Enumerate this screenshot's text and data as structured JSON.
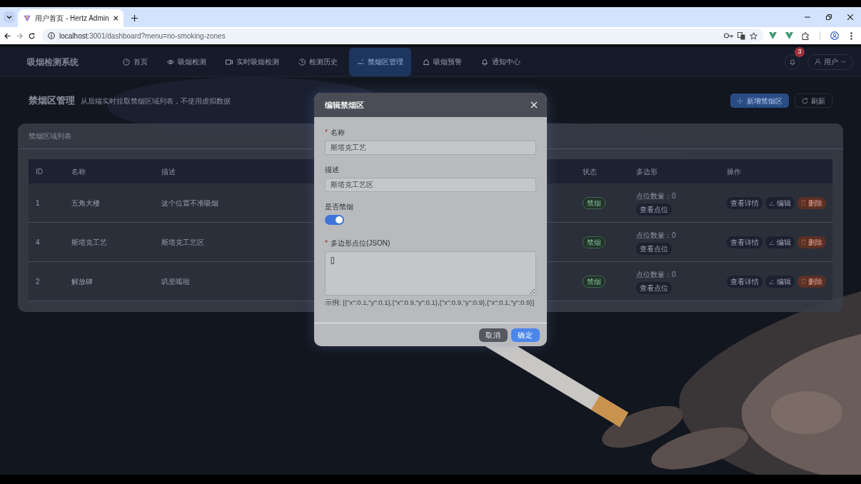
{
  "browser": {
    "tab_title": "用户首页 - Hertz Admin",
    "url_host": "localhost",
    "url_rest": ":3001/dashboard?menu=no-smoking-zones"
  },
  "app": {
    "brand": "吸烟检测系统",
    "nav": [
      {
        "label": "首页",
        "selected": false
      },
      {
        "label": "吸烟检测",
        "selected": false
      },
      {
        "label": "实时吸烟检测",
        "selected": false
      },
      {
        "label": "检测历史",
        "selected": false
      },
      {
        "label": "禁烟区管理",
        "selected": true
      },
      {
        "label": "吸烟预警",
        "selected": false
      },
      {
        "label": "通知中心",
        "selected": false
      }
    ],
    "notification_count": "3",
    "user": "用户"
  },
  "page": {
    "title": "禁烟区管理",
    "subtitle": "从后端实时拉取禁烟区域列表，不使用虚拟数据",
    "add_button": "新增禁烟区",
    "refresh_button": "刷新"
  },
  "table_card": {
    "title": "禁烟区域列表",
    "columns": [
      "ID",
      "名称",
      "描述",
      "状态",
      "多边形",
      "操作"
    ],
    "rows": [
      {
        "id": "1",
        "name": "五角大楼",
        "description": "这个位置不准吸烟",
        "status": "禁烟",
        "point_count": "点位数量：0",
        "view_points": "查看点位",
        "actions": [
          "查看详情",
          "编辑",
          "删除"
        ]
      },
      {
        "id": "4",
        "name": "斯塔克工艺",
        "description": "斯塔克工艺区",
        "status": "禁烟",
        "point_count": "点位数量：0",
        "view_points": "查看点位",
        "actions": [
          "查看详情",
          "编辑",
          "删除"
        ]
      },
      {
        "id": "2",
        "name": "解放碑",
        "description": "叽里呱啦",
        "status": "禁烟",
        "point_count": "点位数量：0",
        "view_points": "查看点位",
        "actions": [
          "查看详情",
          "编辑",
          "删除"
        ]
      }
    ]
  },
  "modal": {
    "title": "编辑禁烟区",
    "fields": [
      {
        "kind": "text",
        "required_mark": "*",
        "label": "名称",
        "value": "斯塔克工艺"
      },
      {
        "kind": "text",
        "label": "描述",
        "value": "斯塔克工艺区"
      },
      {
        "kind": "switch",
        "label": "是否禁烟",
        "on": true
      },
      {
        "kind": "textarea",
        "required_mark": "*",
        "label": "多边形点位(JSON)",
        "value": "[]",
        "hint": "示例: [{\"x\":0.1,\"y\":0.1},{\"x\":0.9,\"y\":0.1},{\"x\":0.9,\"y\":0.9},{\"x\":0.1,\"y\":0.9}]"
      }
    ],
    "buttons": [
      {
        "label": "取消",
        "kind": "secondary"
      },
      {
        "label": "确定",
        "kind": "primary"
      }
    ]
  }
}
